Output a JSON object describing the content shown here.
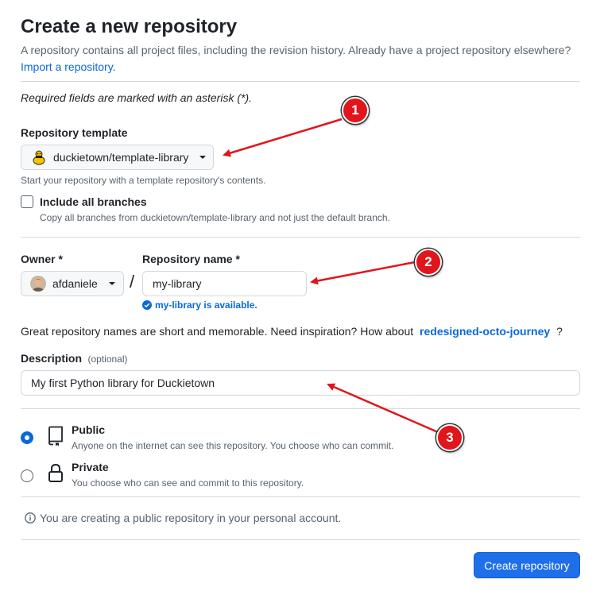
{
  "header": {
    "title": "Create a new repository",
    "subtitle": "A repository contains all project files, including the revision history. Already have a project repository elsewhere?",
    "import_link": "Import a repository."
  },
  "required_note": "Required fields are marked with an asterisk (*).",
  "template": {
    "label": "Repository template",
    "selected": "duckietown/template-library",
    "hint": "Start your repository with a template repository's contents."
  },
  "include_branches": {
    "label": "Include all branches",
    "hint": "Copy all branches from duckietown/template-library and not just the default branch.",
    "checked": false
  },
  "owner": {
    "label": "Owner *",
    "value": "afdaniele"
  },
  "separator": "/",
  "repo_name": {
    "label": "Repository name *",
    "value": "my-library",
    "availability": "my-library is available."
  },
  "inspiration": {
    "text": "Great repository names are short and memorable. Need inspiration? How about",
    "suggestion": "redesigned-octo-journey",
    "end": "?"
  },
  "description": {
    "label": "Description",
    "optional": "(optional)",
    "value": "My first Python library for Duckietown"
  },
  "visibility": {
    "selected": "public",
    "options": [
      {
        "id": "public",
        "label": "Public",
        "hint": "Anyone on the internet can see this repository. You choose who can commit.",
        "icon": "repo-icon"
      },
      {
        "id": "private",
        "label": "Private",
        "hint": "You choose who can see and commit to this repository.",
        "icon": "lock-icon"
      }
    ]
  },
  "info_note": "You are creating a public repository in your personal account.",
  "submit_label": "Create repository",
  "annotations": [
    "1",
    "2",
    "3"
  ],
  "colors": {
    "accent": "#0969da",
    "primary_button": "#1f6feb",
    "success": "#1a7f37",
    "annotation": "#e0161c"
  }
}
